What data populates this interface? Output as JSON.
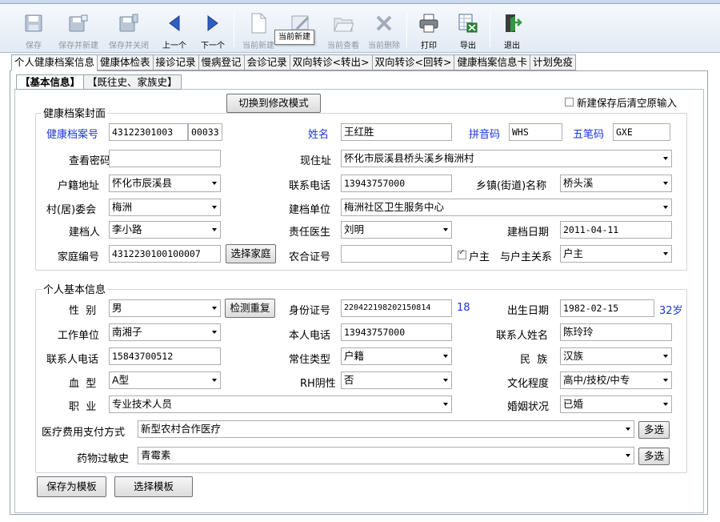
{
  "toolbar": {
    "save": "保存",
    "save_new": "保存并新建",
    "save_close": "保存并关闭",
    "prev": "上一个",
    "next": "下一个",
    "current_new": "当前新建",
    "current_view": "当前查看",
    "current_delete": "当前删除",
    "print": "打印",
    "export": "导出",
    "exit": "退出",
    "tooltip": "当前新建"
  },
  "main_tabs": [
    "个人健康档案信息",
    "健康体检表",
    "接诊记录",
    "慢病登记",
    "会诊记录",
    "双向转诊<转出>",
    "双向转诊<回转>",
    "健康档案信息卡",
    "计划免疫"
  ],
  "sub_tabs": [
    "【基本信息】",
    "【既往史、家族史】"
  ],
  "switch_mode_button": "切换到修改模式",
  "clear_after_save_label": "新建保存后清空原输入",
  "cover": {
    "legend": "健康档案封面",
    "labels": {
      "record_no": "健康档案号",
      "name": "姓名",
      "pinyin": "拼音码",
      "wubi": "五笔码",
      "view_password": "查看密码",
      "current_address": "现住址",
      "household_address": "户籍地址",
      "phone": "联系电话",
      "township": "乡镇(街道)名称",
      "village": "村(居)委会",
      "unit": "建档单位",
      "creator": "建档人",
      "doctor": "责任医生",
      "create_date": "建档日期",
      "family_no": "家庭编号",
      "rural_card": "农合证号",
      "head_of_household": "户主",
      "relation": "与户主关系"
    },
    "values": {
      "record_no_1": "43122301003",
      "record_no_2": "00033",
      "name": "王红胜",
      "pinyin": "WHS",
      "wubi": "GXE",
      "view_password": "",
      "current_address": "怀化市辰溪县桥头溪乡梅洲村",
      "household_address": "怀化市辰溪县",
      "phone": "13943757000",
      "township": "桥头溪",
      "village": "梅洲",
      "unit": "梅洲社区卫生服务中心",
      "creator": "李小路",
      "doctor": "刘明",
      "create_date": "2011-04-11",
      "family_no": "4312230100100007",
      "rural_card": "",
      "relation": "户主"
    },
    "choose_family_button": "选择家庭"
  },
  "personal": {
    "legend": "个人基本信息",
    "labels": {
      "gender": "性  别",
      "id_no": "身份证号",
      "birth": "出生日期",
      "work_unit": "工作单位",
      "own_phone": "本人电话",
      "contact_name": "联系人姓名",
      "contact_phone": "联系人电话",
      "residence_type": "常住类型",
      "ethnicity": "民  族",
      "blood_type": "血  型",
      "rh": "RH阴性",
      "education": "文化程度",
      "occupation": "职  业",
      "marital": "婚姻状况",
      "payment": "医疗费用支付方式",
      "allergy": "药物过敏史"
    },
    "values": {
      "gender": "男",
      "id_no": "220422198202150814",
      "id_len": "18",
      "birth": "1982-02-15",
      "age": "32岁",
      "work_unit": "南湘子",
      "own_phone": "13943757000",
      "contact_name": "陈玲玲",
      "contact_phone": "15843700512",
      "residence_type": "户籍",
      "ethnicity": "汉族",
      "blood_type": "A型",
      "rh": "否",
      "education": "高中/技校/中专",
      "occupation": "专业技术人员",
      "marital": "已婚",
      "payment": "新型农村合作医疗",
      "allergy": "青霉素"
    },
    "check_dup_button": "检测重复",
    "multi_select_button": "多选"
  },
  "save_template_button": "保存为模板",
  "choose_template_button": "选择模板",
  "colors": {
    "label_blue": "#1a35e0",
    "toolbar_bg": "#e2eaf4"
  }
}
